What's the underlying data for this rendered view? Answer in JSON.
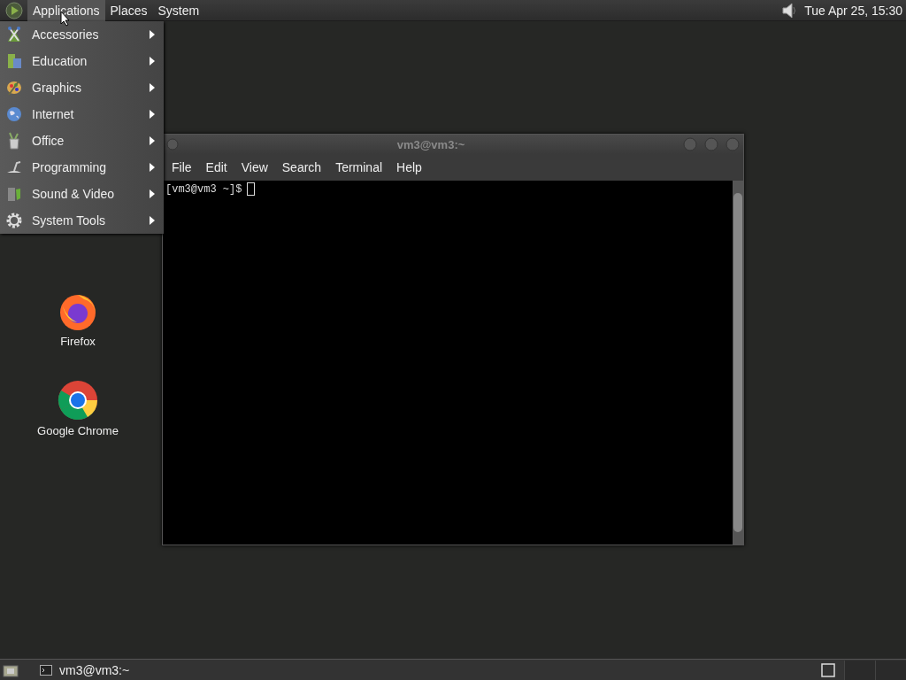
{
  "top_panel": {
    "menus": [
      {
        "label": "Applications",
        "selected": true
      },
      {
        "label": "Places",
        "selected": false
      },
      {
        "label": "System",
        "selected": false
      }
    ],
    "clock": "Tue Apr 25, 15:30"
  },
  "applications_menu": {
    "items": [
      {
        "label": "Accessories",
        "kind": "accessories"
      },
      {
        "label": "Education",
        "kind": "education"
      },
      {
        "label": "Graphics",
        "kind": "graphics"
      },
      {
        "label": "Internet",
        "kind": "internet"
      },
      {
        "label": "Office",
        "kind": "office"
      },
      {
        "label": "Programming",
        "kind": "programming"
      },
      {
        "label": "Sound & Video",
        "kind": "sound"
      },
      {
        "label": "System Tools",
        "kind": "tools"
      }
    ]
  },
  "desktop_icons": [
    {
      "label": "Firefox",
      "kind": "firefox"
    },
    {
      "label": "Google Chrome",
      "kind": "chrome"
    }
  ],
  "terminal": {
    "title": "vm3@vm3:~",
    "menu": [
      "File",
      "Edit",
      "View",
      "Search",
      "Terminal",
      "Help"
    ],
    "prompt": "[vm3@vm3 ~]$"
  },
  "taskbar": {
    "tasks": [
      {
        "label": "vm3@vm3:~"
      }
    ]
  }
}
